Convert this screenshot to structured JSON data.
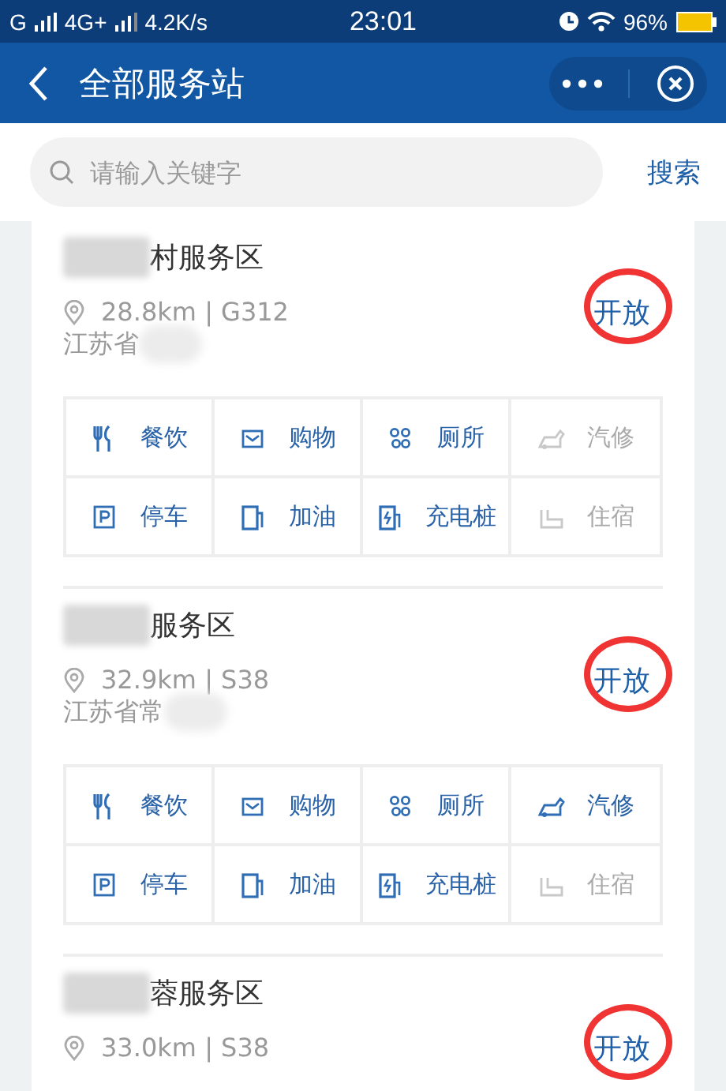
{
  "status_bar": {
    "carrier": "G",
    "network": "4G+",
    "speed": "4.2K/s",
    "time": "23:01",
    "battery": "96%"
  },
  "header": {
    "title": "全部服务站"
  },
  "search": {
    "placeholder": "请输入关键字",
    "button": "搜索"
  },
  "stations": [
    {
      "name": "村服务区",
      "distance": "28.8km | G312",
      "address": "江苏省",
      "status": "开放",
      "circled": true,
      "facilities": [
        {
          "kind": "food",
          "label": "餐饮",
          "available": true
        },
        {
          "kind": "shop",
          "label": "购物",
          "available": true
        },
        {
          "kind": "toilet",
          "label": "厕所",
          "available": true
        },
        {
          "kind": "repair",
          "label": "汽修",
          "available": false
        },
        {
          "kind": "parking",
          "label": "停车",
          "available": true
        },
        {
          "kind": "fuel",
          "label": "加油",
          "available": true
        },
        {
          "kind": "charge",
          "label": "充电桩",
          "available": true
        },
        {
          "kind": "hotel",
          "label": "住宿",
          "available": false
        }
      ]
    },
    {
      "name": "服务区",
      "distance": "32.9km | S38",
      "address": "江苏省常",
      "status": "开放",
      "circled": true,
      "facilities": [
        {
          "kind": "food",
          "label": "餐饮",
          "available": true
        },
        {
          "kind": "shop",
          "label": "购物",
          "available": true
        },
        {
          "kind": "toilet",
          "label": "厕所",
          "available": true
        },
        {
          "kind": "repair",
          "label": "汽修",
          "available": true
        },
        {
          "kind": "parking",
          "label": "停车",
          "available": true
        },
        {
          "kind": "fuel",
          "label": "加油",
          "available": true
        },
        {
          "kind": "charge",
          "label": "充电桩",
          "available": true
        },
        {
          "kind": "hotel",
          "label": "住宿",
          "available": false
        }
      ]
    },
    {
      "name": "蓉服务区",
      "distance": "33.0km | S38",
      "status": "开放",
      "circled": true
    }
  ]
}
